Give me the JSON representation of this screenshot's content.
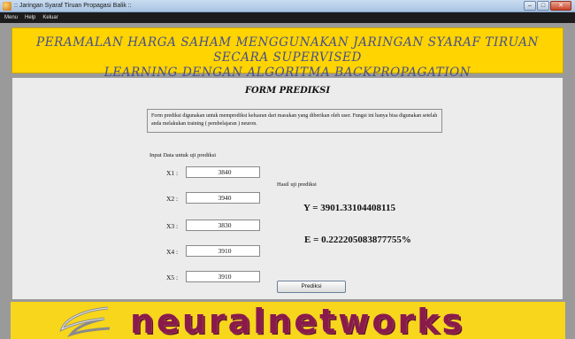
{
  "window": {
    "title": ":: Jaringan Syaraf Tiruan Propagasi Balik ::",
    "buttons": {
      "minimize": "–",
      "maximize": "□",
      "close": "✕"
    }
  },
  "menu": {
    "items": [
      "Menu",
      "Help",
      "Keluar"
    ]
  },
  "header": {
    "line1": "PERAMALAN HARGA SAHAM MENGGUNAKAN JARINGAN SYARAF TIRUAN SECARA SUPERVISED",
    "line2": "LEARNING DENGAN ALGORITMA BACKPROPAGATION"
  },
  "form": {
    "title": "FORM PREDIKSI",
    "description": "Form prediksi digunakan untuk memprediksi keluaran dari masukan yang diberikan oleh user. Fungsi ini hanya bisa digunakan setelah anda melakukan training ( pembelajaran ) neuron.",
    "input_heading": "Input Data untuk uji prediksi",
    "inputs": [
      {
        "label": "X1 :",
        "value": "3840"
      },
      {
        "label": "X2 :",
        "value": "3940"
      },
      {
        "label": "X3 :",
        "value": "3830"
      },
      {
        "label": "X4 :",
        "value": "3910"
      },
      {
        "label": "X5 :",
        "value": "3910"
      }
    ],
    "result_label": "Hasil uji prediksi",
    "result_y": "Y = 3901.33104408115",
    "result_e": "E = 0.222205083877755%",
    "predict_button": "Prediksi"
  },
  "footer": {
    "brand_text": "neuralnetworks"
  },
  "colors": {
    "header_bg": "#ffd400",
    "header_text": "#474f8c",
    "footer_text": "#8a1a4a",
    "frame_bg": "#9a9a9a"
  }
}
